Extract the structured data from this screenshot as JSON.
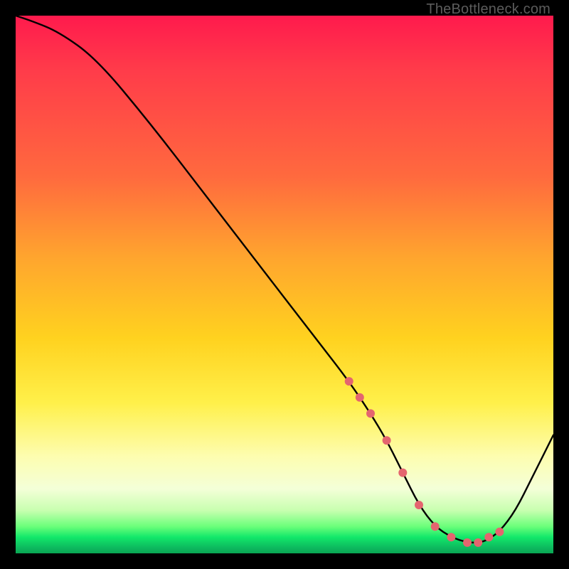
{
  "watermark": "TheBottleneck.com",
  "chart_data": {
    "type": "line",
    "title": "",
    "xlabel": "",
    "ylabel": "",
    "xlim": [
      0,
      100
    ],
    "ylim": [
      0,
      100
    ],
    "series": [
      {
        "name": "curve",
        "x": [
          0,
          3,
          8,
          15,
          25,
          35,
          45,
          55,
          62,
          66,
          69,
          72,
          75,
          78,
          81,
          84,
          87,
          90,
          93,
          96,
          100
        ],
        "y": [
          100,
          99,
          97,
          92,
          80,
          67,
          54,
          41,
          32,
          26,
          21,
          15,
          9,
          5,
          3,
          2,
          2,
          4,
          8,
          14,
          22
        ]
      }
    ],
    "markers": {
      "x": [
        62,
        64,
        66,
        69,
        72,
        75,
        78,
        81,
        84,
        86,
        88,
        90
      ],
      "y": [
        32,
        29,
        26,
        21,
        15,
        9,
        5,
        3,
        2,
        2,
        3,
        4
      ],
      "color": "#e4656f",
      "radius": 6
    },
    "background_gradient": {
      "stops": [
        {
          "pos": 0.0,
          "color": "#ff1a4d"
        },
        {
          "pos": 0.3,
          "color": "#ff6a3e"
        },
        {
          "pos": 0.6,
          "color": "#ffd21f"
        },
        {
          "pos": 0.85,
          "color": "#fdfdb0"
        },
        {
          "pos": 0.95,
          "color": "#6bff7a"
        },
        {
          "pos": 1.0,
          "color": "#0aa653"
        }
      ]
    }
  }
}
